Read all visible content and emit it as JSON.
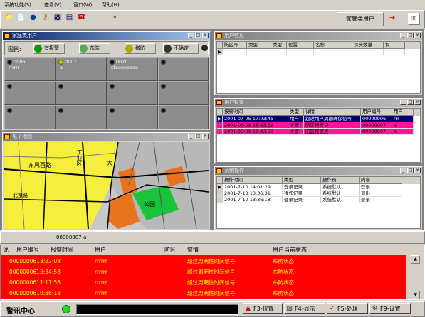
{
  "menu": [
    "系统功能(S)",
    "查看(V)",
    "窗口(W)",
    "帮助(H)"
  ],
  "toolbar": {
    "icons": [
      "folder-icon",
      "document-icon",
      "globe-icon",
      "key-icon",
      "window-icon",
      "monitor-icon",
      "phone-icon",
      "help-icon"
    ],
    "user_label": "家庭类用户",
    "arrow": "➔"
  },
  "family_window": {
    "title": "家庭类用户",
    "filter_label": "图例:",
    "legend": [
      "有报警",
      "布防",
      "撤防",
      "不确定"
    ],
    "cells": [
      {
        "id": "0006",
        "name": "rrrrrr",
        "state": "off"
      },
      {
        "id": "0007",
        "name": "a",
        "state": "yellow"
      },
      {
        "id": "0070",
        "name": "cfeeeeeeee",
        "state": "off"
      },
      {
        "id": "",
        "name": "",
        "state": "off"
      }
    ]
  },
  "user_info_window": {
    "title": "用户信息",
    "columns": [
      "防区号",
      "类型",
      "类型",
      "位置",
      "名称",
      "探头数量",
      "探"
    ],
    "rows": []
  },
  "user_alarm_window": {
    "title": "用户报警",
    "columns": [
      "报警时间",
      "类型",
      "详情",
      "用户编号",
      "用户"
    ],
    "rows": [
      {
        "time": "2001-07-05 17:03:45",
        "type": "用户",
        "detail": "超过用户周期确保信号",
        "user_no": "00000006",
        "user": "rrr",
        "style": "sel"
      },
      {
        "time": "2001-06-09 18:43:52",
        "type": "火警",
        "detail": "防区报警点",
        "user_no": "00000007",
        "user": "a",
        "style": "pink"
      },
      {
        "time": "2001-06-09 18:43:50",
        "type": "火警",
        "detail": "防区报警点",
        "user_no": "00000007",
        "user": "a",
        "style": "pink"
      }
    ]
  },
  "map_window": {
    "title": "电子地图",
    "labels": [
      "工业区",
      "东风西路",
      "大",
      "公园",
      "北京路"
    ]
  },
  "system_log_window": {
    "title": "系统操作",
    "columns": [
      "操作时间",
      "类型",
      "操作员",
      "内容"
    ],
    "rows": [
      {
        "time": "2001-7-10 14:01:29",
        "type": "登录记录",
        "op": "系统默认",
        "content": "登录"
      },
      {
        "time": "2001-7-10 13:36:31",
        "type": "操作记录",
        "op": "系统默认",
        "content": "退出"
      },
      {
        "time": "2001-7-10 13:36:18",
        "type": "登录记录",
        "op": "系统默认",
        "content": "登录"
      }
    ]
  },
  "bottom_bar": {
    "field": "00000007-a"
  },
  "alarm_table": {
    "columns": [
      "说",
      "用户编号",
      "报警时间",
      "用户",
      "防区",
      "警情",
      "用户当前状态"
    ],
    "rows": [
      {
        "no": "0000000613:22:08",
        "user": "rrrrrr",
        "detail": "超过周期性时间信号",
        "status": "布防状态"
      },
      {
        "no": "0000000613:34:58",
        "user": "rrrrrr",
        "detail": "超过周期性时间信号",
        "status": "布防状态"
      },
      {
        "no": "0000000611:11:56",
        "user": "rrrrrr",
        "detail": "超过周期性时间信号",
        "status": "布防状态"
      },
      {
        "no": "0000000610:36:18",
        "user": "rrrrrr",
        "detail": "超过周期性时间信号",
        "status": "布防状态"
      }
    ]
  },
  "status_bar": {
    "label": "警讯中心",
    "f3": "F3-位置",
    "f4": "F4-显示",
    "f5": "F5-处理",
    "f9": "F9-设置"
  }
}
